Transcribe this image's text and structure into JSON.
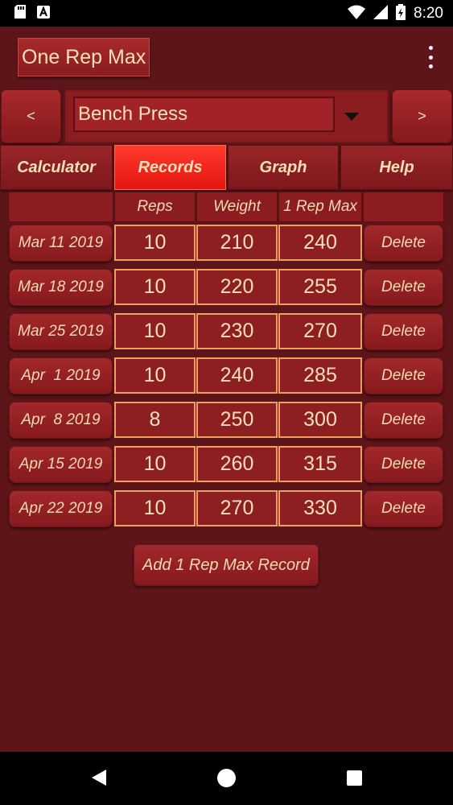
{
  "status_bar": {
    "time": "8:20",
    "icons": [
      "sd-card-icon",
      "a-notification-icon",
      "wifi-icon",
      "signal-icon",
      "battery-icon"
    ]
  },
  "app_bar": {
    "title": "One Rep Max",
    "menu_icon": "overflow-menu-icon"
  },
  "selector": {
    "prev_label": "<",
    "next_label": ">",
    "exercise": "Bench Press"
  },
  "tabs": [
    {
      "label": "Calculator",
      "active": false
    },
    {
      "label": "Records",
      "active": true
    },
    {
      "label": "Graph",
      "active": false
    },
    {
      "label": "Help",
      "active": false
    }
  ],
  "table": {
    "headers": [
      "",
      "Reps",
      "Weight",
      "1 Rep Max",
      ""
    ],
    "rows": [
      {
        "date": "Mar 11 2019",
        "reps": "10",
        "weight": "210",
        "max": "240",
        "action": "Delete"
      },
      {
        "date": "Mar 18 2019",
        "reps": "10",
        "weight": "220",
        "max": "255",
        "action": "Delete"
      },
      {
        "date": "Mar 25 2019",
        "reps": "10",
        "weight": "230",
        "max": "270",
        "action": "Delete"
      },
      {
        "date": "Apr  1 2019",
        "reps": "10",
        "weight": "240",
        "max": "285",
        "action": "Delete"
      },
      {
        "date": "Apr  8 2019",
        "reps": "8",
        "weight": "250",
        "max": "300",
        "action": "Delete"
      },
      {
        "date": "Apr 15 2019",
        "reps": "10",
        "weight": "260",
        "max": "315",
        "action": "Delete"
      },
      {
        "date": "Apr 22 2019",
        "reps": "10",
        "weight": "270",
        "max": "330",
        "action": "Delete"
      }
    ]
  },
  "add_button_label": "Add 1 Rep Max Record",
  "colors": {
    "background": "#5e1519",
    "button": "#a2282b",
    "active_tab": "#ff3a2e",
    "cell_border": "#f0a05e",
    "text": "#f3dcb0"
  }
}
